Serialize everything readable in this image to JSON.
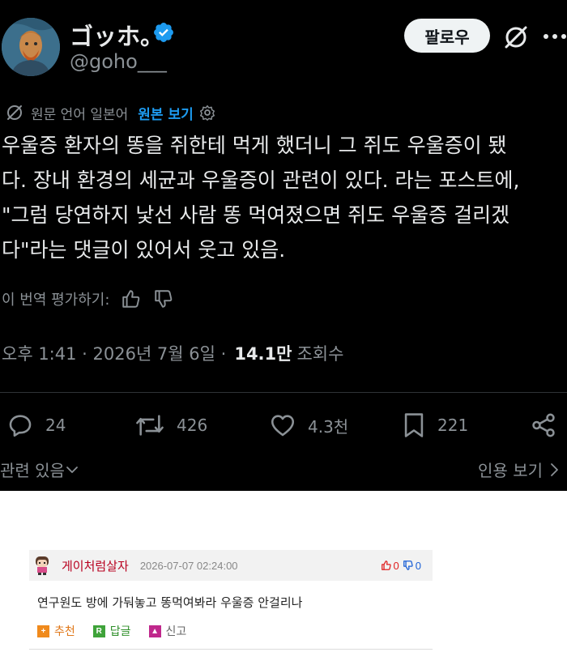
{
  "tweet": {
    "author_name": "ゴッホ。",
    "handle": "@goho___",
    "follow_label": "팔로우",
    "translate": {
      "source_label": "원문 언어 일본어",
      "show_original_label": "원본 보기"
    },
    "text_lines": [
      "우울증 환자의 똥을 쥐한테 먹게 했더니 그 쥐도 우울증이 됐",
      "다. 장내 환경의 세균과 우울증이 관련이 있다. 라는 포스트에,",
      "\"그럼 당연하지 낯선 사람 똥 먹여졌으면 쥐도 우울증 걸리겠",
      "다\"라는 댓글이 있어서 웃고 있음."
    ],
    "rate_label": "이 번역 평가하기:",
    "meta": {
      "time": "오후 1:41 · 2026년 7월 6일 ·",
      "views_count": "14.1만",
      "views_label": "조회수"
    },
    "actions": {
      "replies": "24",
      "reposts": "426",
      "likes": "4.3천",
      "bookmarks": "221"
    },
    "related_label": "관련 있음",
    "quotes_label": "인용 보기"
  },
  "comment": {
    "nickname": "게이처럼살자",
    "date": "2026-07-07 02:24:00",
    "up_count": "0",
    "down_count": "0",
    "body": "연구원도 방에 가둬놓고 똥먹여봐라 우울증 안걸리나",
    "actions": {
      "recommend": "추천",
      "reply": "답글",
      "report": "신고"
    }
  },
  "colors": {
    "tweet_bg": "#000000",
    "accent_blue": "#1d9bf0",
    "muted_text": "#8b9196",
    "nickname_red": "#b8001f"
  },
  "icons": [
    "verified-badge-icon",
    "grok-icon",
    "more-icon",
    "translate-globe-icon",
    "settings-gear-icon",
    "thumbs-up-icon",
    "thumbs-down-icon",
    "reply-icon",
    "repost-icon",
    "like-icon",
    "bookmark-icon",
    "share-icon",
    "chevron-down-icon",
    "chevron-right-icon"
  ]
}
